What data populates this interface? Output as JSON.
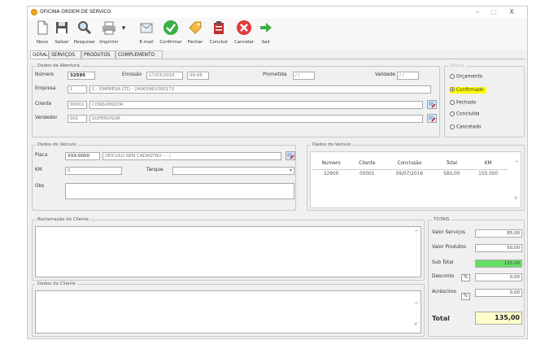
{
  "window": {
    "title": "OFICINA ORDEM DE SERVICO",
    "minimize": "–",
    "maximize": "□",
    "close": "X"
  },
  "toolbar": {
    "novo": "Novo",
    "salvar": "Salvar",
    "pesquisar": "Pesquisar",
    "imprimir": "Imprimir",
    "email": "E-mail",
    "confirmar": "Confirmar",
    "fechar": "Fechar",
    "concluir": "Concluir",
    "cancelar": "Cancelar",
    "sair": "Sair"
  },
  "tabs": {
    "geral": "GERAL",
    "servicos": "SERVIÇOS",
    "produtos": "PRODUTOS",
    "complemento": "COMPLEMENTO"
  },
  "abertura": {
    "legend": "Dados de Abertura",
    "numero_label": "Número",
    "numero": "32595",
    "emissao_label": "Emissão",
    "emissao_data": "17/03/2016",
    "emissao_hora": "09:06",
    "prometida_label": "Prometida",
    "prometida": "/ /",
    "validade_label": "Validade",
    "validade": "/ /",
    "empresa_label": "Empresa",
    "empresa_cod": "1",
    "empresa_nome": "1 - EMPRESA LTD - 24963961000172",
    "cliente_label": "Cliente",
    "cliente_cod": "00001",
    "cliente_nome": "CONSUMIDOR",
    "vendedor_label": "Vendedor",
    "vendedor_cod": "001",
    "vendedor_nome": "SUPERVISOR"
  },
  "status": {
    "legend": "Status",
    "options": [
      "Orçamento",
      "Confirmado",
      "Fechado",
      "Concluída",
      "Cancelado"
    ],
    "selected": "Confirmado"
  },
  "veiculo": {
    "legend": "Dados do Veiculo",
    "placa_label": "Placa",
    "placa": "XXX-0000",
    "placa_desc": "VEICULO SEM CADASTRO - - /",
    "km_label": "KM",
    "km": "0",
    "tanque_label": "Tanque",
    "obs_label": "Obs"
  },
  "veiculo_grid": {
    "legend": "Dados do Veiculo",
    "headers": [
      "Numero",
      "Cliente",
      "Conclusão",
      "Total",
      "KM"
    ],
    "rows": [
      [
        "32900",
        "00001",
        "09/07/2016",
        "580,00",
        "150.000"
      ]
    ]
  },
  "reclamacao": {
    "legend": "Reclamação do Cliente"
  },
  "dados_cliente": {
    "legend": "Dados do Cliente"
  },
  "totais": {
    "legend": "TOTAIS",
    "servicos_label": "Valor Serviços",
    "servicos": "85,00",
    "produtos_label": "Valor Produtos",
    "produtos": "50,00",
    "subtotal_label": "Sub Total",
    "subtotal": "135,00",
    "desconto_label": "Desconto",
    "desconto": "0,00",
    "acrescimo_label": "Acréscimo",
    "acrescimo": "0,00",
    "total_label": "Total",
    "total": "135,00",
    "pct_symbol": "%"
  },
  "colors": {
    "highlight": "#ffff00",
    "subtotal_bg": "#66e066",
    "total_bg": "#ffffcc",
    "confirm_green": "#3cb043",
    "cancel_red": "#e23b3b"
  }
}
